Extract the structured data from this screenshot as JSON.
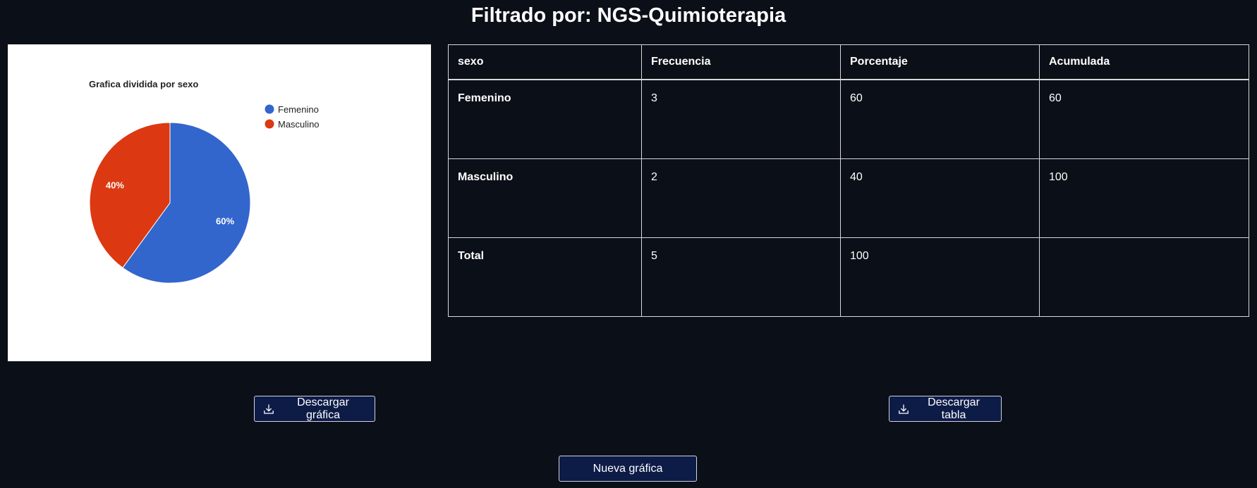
{
  "page": {
    "title": "Filtrado por: NGS-Quimioterapia"
  },
  "chart_data": {
    "type": "pie",
    "title": "Grafica dividida por sexo",
    "categories": [
      "Femenino",
      "Masculino"
    ],
    "values": [
      3,
      2
    ],
    "labels": [
      "60%",
      "40%"
    ],
    "colors": [
      "#3366cc",
      "#dc3912"
    ],
    "legend": "right"
  },
  "table": {
    "headers": [
      "sexo",
      "Frecuencia",
      "Porcentaje",
      "Acumulada"
    ],
    "rows": [
      [
        "Femenino",
        "3",
        "60",
        "60"
      ],
      [
        "Masculino",
        "2",
        "40",
        "100"
      ],
      [
        "Total",
        "5",
        "100",
        ""
      ]
    ]
  },
  "buttons": {
    "download_chart": "Descargar gráfica",
    "download_table": "Descargar tabla",
    "new_chart": "Nueva gráfica"
  },
  "icons": {
    "download": "download-icon"
  }
}
